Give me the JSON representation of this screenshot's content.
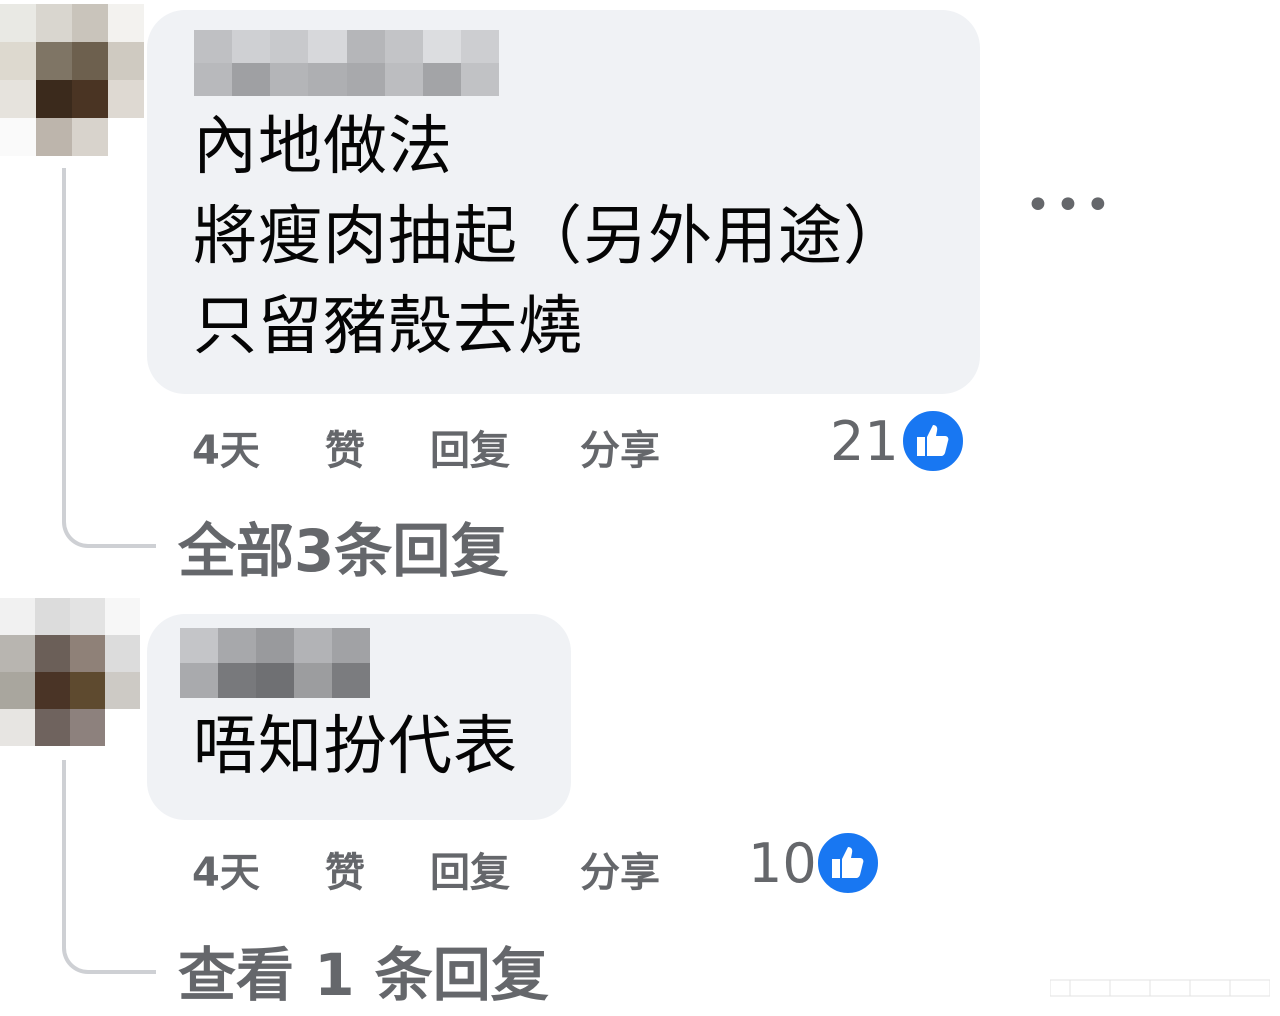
{
  "comments": [
    {
      "text_lines": [
        "內地做法",
        "將瘦肉抽起（另外用途）",
        "只留豬殼去燒"
      ],
      "actions": {
        "time": "4天",
        "like": "赞",
        "reply": "回复",
        "share": "分享"
      },
      "reaction_count": "21",
      "view_replies": "全部3条回复"
    },
    {
      "text_lines": [
        "唔知扮代表"
      ],
      "actions": {
        "time": "4天",
        "like": "赞",
        "reply": "回复",
        "share": "分享"
      },
      "reaction_count": "10",
      "view_replies": "查看 1 条回复"
    }
  ],
  "icons": {
    "more": "more-horizontal-icon",
    "like_reaction": "thumbs-up-icon"
  },
  "colors": {
    "like_blue": "#1877f2",
    "bubble_bg": "#f0f2f5",
    "secondary_text": "#65676b"
  }
}
